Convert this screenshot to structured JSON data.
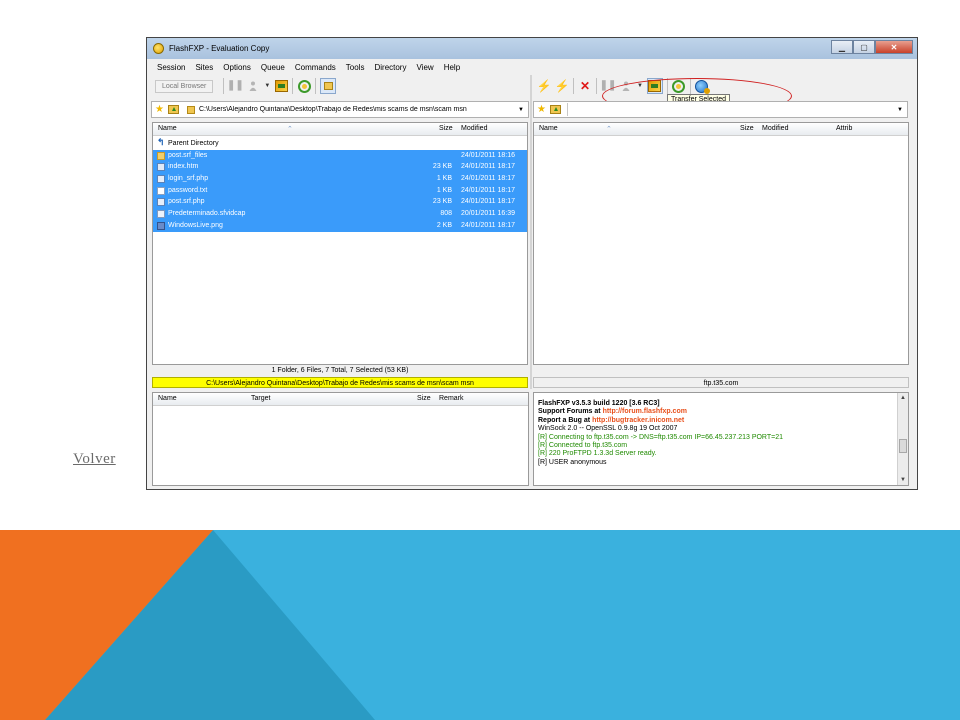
{
  "slide": {
    "volver_link": "Volver",
    "colors": {
      "orange": "#f07020",
      "blue_light": "#3ab1de",
      "blue_mid": "#2a9bc4",
      "blue_dark": "#2389ad"
    }
  },
  "window": {
    "title": "FlashFXP - Evaluation Copy",
    "buttons": {
      "minimize": "▁",
      "maximize": "▢",
      "close": "✕"
    }
  },
  "menu": [
    "Session",
    "Sites",
    "Options",
    "Queue",
    "Commands",
    "Tools",
    "Directory",
    "View",
    "Help"
  ],
  "left_toolbar": {
    "local_browser_label": "Local Browser"
  },
  "tooltip": "Transfer Selected",
  "left_path": "C:\\Users\\Alejandro Quintana\\Desktop\\Trabajo de Redes\\mis scams de msn\\scam msn",
  "right_path": "",
  "left_columns": {
    "name": "Name",
    "size": "Size",
    "modified": "Modified"
  },
  "right_columns": {
    "name": "Name",
    "size": "Size",
    "modified": "Modified",
    "attrib": "Attrib"
  },
  "left_files": [
    {
      "icon": "up-arrow-icon",
      "name": "Parent Directory",
      "size": "",
      "modified": "",
      "selected": false
    },
    {
      "icon": "folder-icon",
      "name": "post.srf_files",
      "size": "",
      "modified": "24/01/2011 18:16",
      "selected": true
    },
    {
      "icon": "html-file-icon",
      "name": "index.htm",
      "size": "23 KB",
      "modified": "24/01/2011 18:17",
      "selected": true
    },
    {
      "icon": "php-file-icon",
      "name": "login_srf.php",
      "size": "1 KB",
      "modified": "24/01/2011 18:17",
      "selected": true
    },
    {
      "icon": "text-file-icon",
      "name": "password.txt",
      "size": "1 KB",
      "modified": "24/01/2011 18:17",
      "selected": true
    },
    {
      "icon": "php-file-icon",
      "name": "post.srf.php",
      "size": "23 KB",
      "modified": "24/01/2011 18:17",
      "selected": true
    },
    {
      "icon": "capture-file-icon",
      "name": "Predeterminado.sfvidcap",
      "size": "808",
      "modified": "20/01/2011 16:39",
      "selected": true
    },
    {
      "icon": "image-file-icon",
      "name": "WindowsLive.png",
      "size": "2 KB",
      "modified": "24/01/2011 18:17",
      "selected": true
    }
  ],
  "left_status": "1 Folder, 6 Files, 7 Total, 7 Selected (53 KB)",
  "left_path_status": "C:\\Users\\Alejandro Quintana\\Desktop\\Trabajo de Redes\\mis scams de msn\\scam msn",
  "right_path_status": "ftp.t35.com",
  "queue_columns": {
    "name": "Name",
    "target": "Target",
    "size": "Size",
    "remark": "Remark"
  },
  "log": [
    {
      "style": "bold",
      "parts": [
        {
          "text": "FlashFXP v3.5.3 build 1220 [3.6 RC3]",
          "link": false
        }
      ]
    },
    {
      "style": "bold",
      "parts": [
        {
          "text": "Support Forums at ",
          "link": false
        },
        {
          "text": "http://forum.flashfxp.com",
          "link": true
        }
      ]
    },
    {
      "style": "bold",
      "parts": [
        {
          "text": "Report a Bug at ",
          "link": false
        },
        {
          "text": "http://bugtracker.inicom.net",
          "link": true
        }
      ]
    },
    {
      "style": "blank",
      "parts": [
        {
          "text": " ",
          "link": false
        }
      ]
    },
    {
      "style": "plain",
      "parts": [
        {
          "text": "WinSock 2.0 -- OpenSSL 0.9.8g 19 Oct 2007",
          "link": false
        }
      ]
    },
    {
      "style": "green",
      "parts": [
        {
          "text": "[R] Connecting to ftp.t35.com -> DNS=ftp.t35.com IP=66.45.237.213 PORT=21",
          "link": false
        }
      ]
    },
    {
      "style": "green",
      "parts": [
        {
          "text": "[R] Connected to ftp.t35.com",
          "link": false
        }
      ]
    },
    {
      "style": "green",
      "parts": [
        {
          "text": "[R] 220 ProFTPD 1.3.3d Server ready.",
          "link": false
        }
      ]
    },
    {
      "style": "plain",
      "parts": [
        {
          "text": "[R] USER anonymous",
          "link": false
        }
      ]
    }
  ]
}
